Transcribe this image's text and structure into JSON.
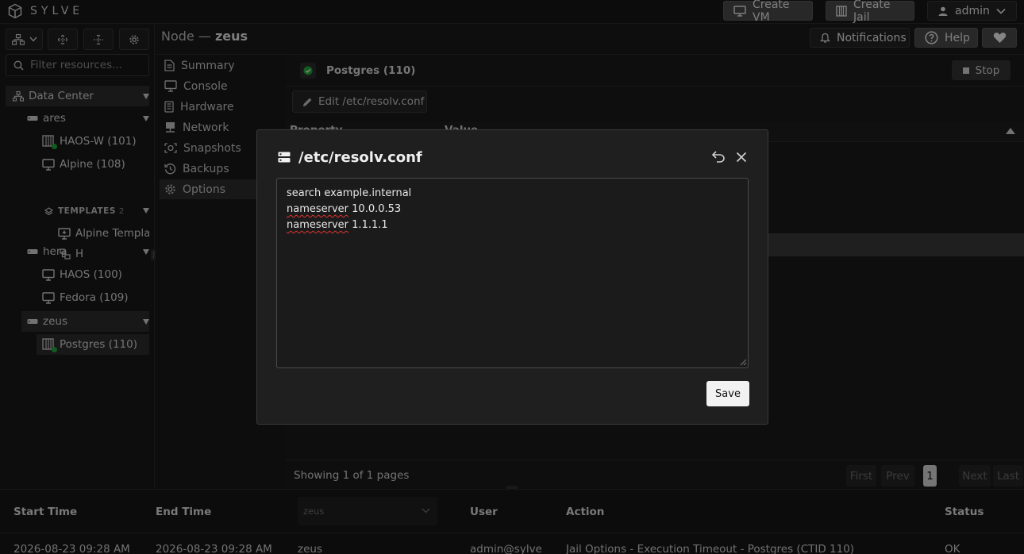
{
  "app": {
    "brand": "SYLVE"
  },
  "topbar": {
    "create_vm": "Create VM",
    "create_jail": "Create Jail",
    "user": "admin"
  },
  "left": {
    "filter_placeholder": "Filter resources...",
    "tree": {
      "datacenter": "Data Center",
      "node_ares": "ares",
      "haos_w": "HAOS-W (101)",
      "alpine": "Alpine (108)",
      "templates": "TEMPLATES",
      "templates_count": "2",
      "alpine_template": "Alpine Template",
      "h": "H",
      "node_hera": "hera",
      "haos": "HAOS (100)",
      "fedora": "Fedora (109)",
      "node_zeus": "zeus",
      "postgres": "Postgres (110)"
    }
  },
  "middle": {
    "title_prefix": "Node —",
    "title_node": "zeus",
    "menu": [
      "Summary",
      "Console",
      "Hardware",
      "Network",
      "Snapshots",
      "Backups",
      "Options"
    ]
  },
  "header_actions": {
    "notifications": "Notifications",
    "help": "Help"
  },
  "right": {
    "resource_title": "Postgres (110)",
    "stop": "Stop",
    "edit_button": "Edit /etc/resolv.conf",
    "col_property": "Property",
    "col_value": "Value",
    "pager_text": "Showing 1 of 1 pages",
    "pager": {
      "first": "First",
      "prev": "Prev",
      "page": "1",
      "next": "Next",
      "last": "Last"
    }
  },
  "modal": {
    "title": "/etc/resolv.conf",
    "line1": "search example.internal",
    "line2_key": "nameserver",
    "line2_val": " 10.0.0.53",
    "line3_key": "nameserver",
    "line3_val": " 1.1.1.1",
    "save": "Save"
  },
  "audit": {
    "headers": {
      "start": "Start Time",
      "end": "End Time",
      "node_select": "zeus",
      "user": "User",
      "action": "Action",
      "status": "Status"
    },
    "row": {
      "start": "2026-08-23 09:28 AM",
      "end": "2026-08-23 09:28 AM",
      "node": "zeus",
      "user": "admin@sylve",
      "action": "Jail Options - Execution Timeout - Postgres (CTID 110)",
      "status": "OK"
    }
  },
  "colors": {
    "running": "#22a83a",
    "background": "#1a1a1a",
    "save_bg": "#f2f2f2"
  }
}
